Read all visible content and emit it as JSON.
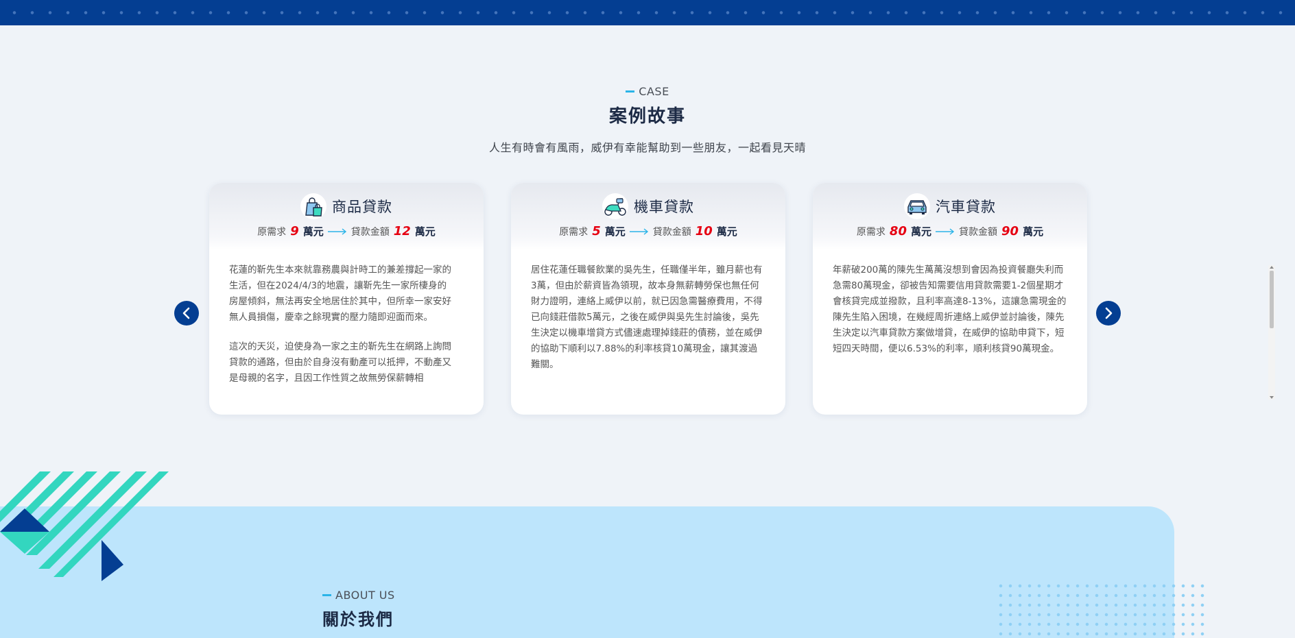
{
  "section": {
    "eyebrow": "CASE",
    "title": "案例故事",
    "subtitle": "人生有時會有風雨，威伊有幸能幫助到一些朋友，一起看見天晴"
  },
  "cards": [
    {
      "icon": "shopping-bag-icon",
      "title": "商品貸款",
      "need_label": "原需求",
      "need_value": "9",
      "need_unit": "萬元",
      "loan_label": "貸款金額",
      "loan_value": "12",
      "loan_unit": "萬元",
      "paragraphs": [
        "花蓮的靳先生本來就靠務農與計時工的兼差撐起一家的生活，但在2024/4/3的地震，讓靳先生一家所棲身的房屋傾斜，無法再安全地居住於其中，但所幸一家安好無人員損傷，慶幸之餘現實的壓力隨即迎面而來。",
        "這次的天災，迫使身為一家之主的靳先生在網路上詢問貸款的通路，但由於自身沒有動產可以抵押，不動產又是母親的名字，且因工作性質之故無勞保薪轉相"
      ]
    },
    {
      "icon": "scooter-icon",
      "title": "機車貸款",
      "need_label": "原需求",
      "need_value": "5",
      "need_unit": "萬元",
      "loan_label": "貸款金額",
      "loan_value": "10",
      "loan_unit": "萬元",
      "paragraphs": [
        "居住花蓮任職餐飲業的吳先生，任職僅半年，雖月薪也有3萬，但由於薪資皆為領現，故本身無薪轉勞保也無任何財力證明，連絡上威伊以前，就已因急需醫療費用，不得已向錢莊借款5萬元，之後在威伊與吳先生討論後，吳先生決定以機車增貸方式儘速處理掉錢莊的債務，並在威伊的協助下順利以7.88%的利率核貸10萬現金，讓其渡過難關。"
      ]
    },
    {
      "icon": "car-icon",
      "title": "汽車貸款",
      "need_label": "原需求",
      "need_value": "80",
      "need_unit": "萬元",
      "loan_label": "貸款金額",
      "loan_value": "90",
      "loan_unit": "萬元",
      "paragraphs": [
        "年薪破200萬的陳先生萬萬沒想到會因為投資餐廳失利而急需80萬現金，卻被告知需要信用貸款需要1-2個星期才會核貸完成並撥款，且利率高達8-13%，這讓急需現金的陳先生陷入困境，在幾經周折連絡上威伊並討論後，陳先生決定以汽車貸款方案做增貸，在威伊的協助申貸下，短短四天時間，便以6.53%的利率，順利核貸90萬現金。"
      ]
    }
  ],
  "about": {
    "eyebrow": "ABOUT US",
    "title": "關於我們"
  },
  "colors": {
    "navy": "#043e92",
    "accent": "#2bb4e8",
    "highlight": "#e60012",
    "about_bg": "#bde5fc",
    "teal": "#33d6bf"
  }
}
